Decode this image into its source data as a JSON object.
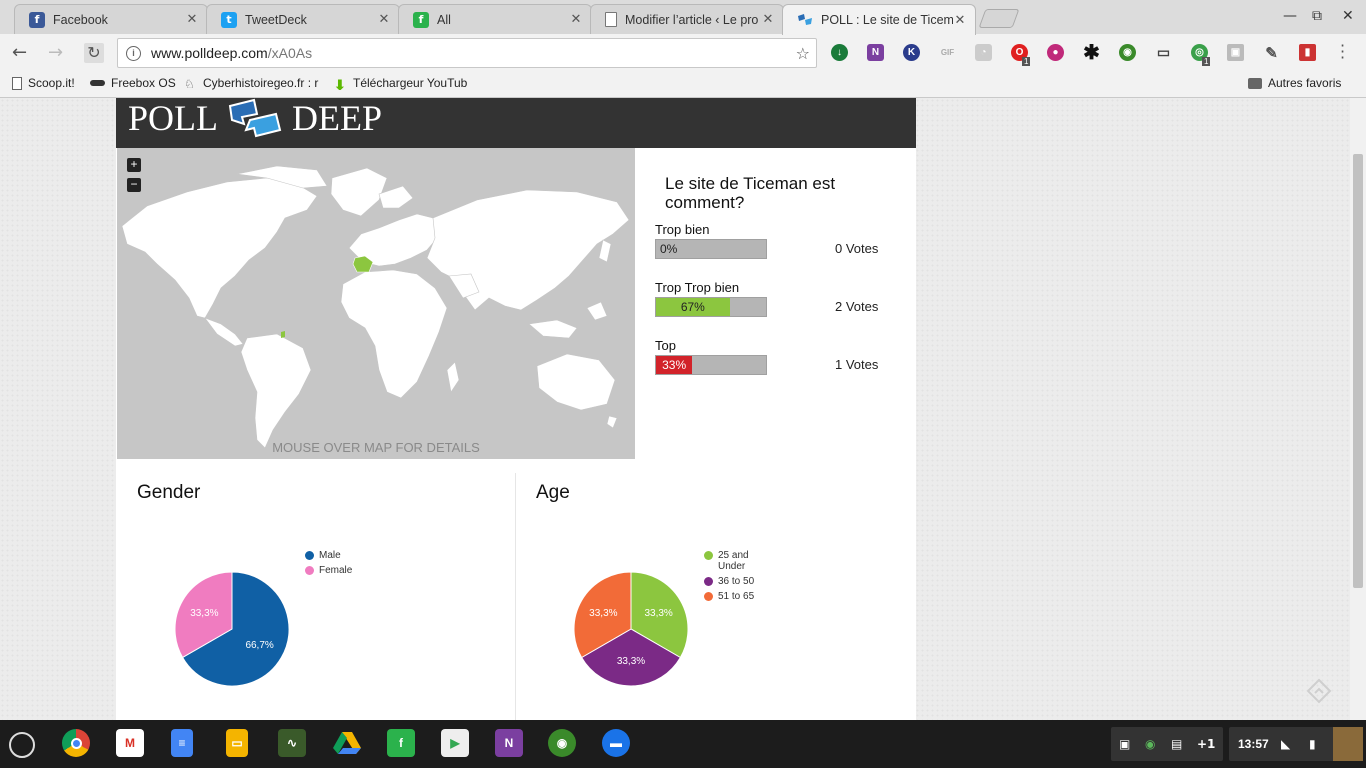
{
  "browser": {
    "tabs": [
      {
        "title": "Facebook",
        "icon": "facebook-icon",
        "color": "#3b5998"
      },
      {
        "title": "TweetDeck",
        "icon": "twitter-icon",
        "color": "#1da1f2"
      },
      {
        "title": "All",
        "icon": "feedly-icon",
        "color": "#2bb24c"
      },
      {
        "title": "Modifier l’article ‹ Le pro",
        "icon": "page-icon",
        "color": "#888888"
      },
      {
        "title": "POLL : Le site de Ticema",
        "icon": "polldeep-icon",
        "color": "#2a6db5"
      }
    ],
    "address": {
      "host": "www.polldeep.com",
      "path": "/xA0As"
    },
    "bookmarks": [
      "Scoop.it!",
      "Freebox OS",
      "Cyberhistoiregeo.fr : r",
      "Téléchargeur YouTub"
    ],
    "other_bookmarks": "Autres favoris",
    "extension_badges": [
      "1",
      "1"
    ]
  },
  "page": {
    "logo_words": [
      "POLL",
      "DEEP"
    ],
    "map_caption": "MOUSE OVER MAP FOR DETAILS",
    "zoom_in": "+",
    "zoom_out": "−",
    "poll": {
      "question": "Le site de Ticeman est comment?",
      "options": [
        {
          "label": "Trop bien",
          "percent": 0,
          "percent_label": "0%",
          "votes": "0 Votes",
          "color": "#b5b5b5"
        },
        {
          "label": "Trop Trop bien",
          "percent": 67,
          "percent_label": "67%",
          "votes": "2 Votes",
          "color": "#8cc63f"
        },
        {
          "label": "Top",
          "percent": 33,
          "percent_label": "33%",
          "votes": "1 Votes",
          "color": "#d2232a"
        }
      ]
    },
    "gender": {
      "title": "Gender",
      "legend": [
        {
          "label": "Male",
          "color": "#1060a5"
        },
        {
          "label": "Female",
          "color": "#f07cc0"
        }
      ]
    },
    "age": {
      "title": "Age",
      "legend": [
        {
          "label": "25 and Under",
          "color": "#8cc63f"
        },
        {
          "label": "36 to 50",
          "color": "#7b2a86"
        },
        {
          "label": "51 to 65",
          "color": "#f26b38"
        }
      ]
    }
  },
  "chart_data": [
    {
      "type": "pie",
      "title": "Gender",
      "categories": [
        "Male",
        "Female"
      ],
      "values": [
        66.7,
        33.3
      ],
      "labels": [
        "66,7%",
        "33,3%"
      ],
      "colors": [
        "#1060a5",
        "#f07cc0"
      ],
      "legend": "right"
    },
    {
      "type": "pie",
      "title": "Age",
      "categories": [
        "25 and Under",
        "36 to 50",
        "51 to 65"
      ],
      "values": [
        33.3,
        33.3,
        33.3
      ],
      "labels": [
        "33,3%",
        "33,3%",
        "33,3%"
      ],
      "colors": [
        "#8cc63f",
        "#7b2a86",
        "#f26b38"
      ],
      "legend": "right"
    }
  ],
  "shelf": {
    "apps": [
      "chrome-icon",
      "gmail-icon",
      "docs-icon",
      "slides-icon",
      "tv-icon",
      "drive-icon",
      "feedly-icon",
      "play-store-icon",
      "onenote-icon",
      "turtle-icon",
      "files-icon"
    ],
    "notification_count": "+1",
    "clock": "13:57"
  }
}
